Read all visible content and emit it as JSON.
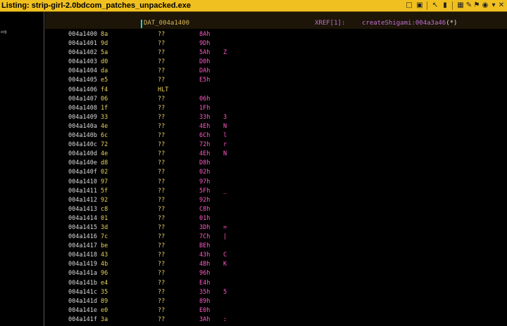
{
  "window": {
    "title": "Listing:  strip-girl-2.0bdcom_patches_unpacked.exe"
  },
  "toolbar_icons": [
    "copy-icon",
    "paste-icon",
    "cursor-icon",
    "arrow-icon",
    "snapshot-icon",
    "edit-icon",
    "flag-icon",
    "camera-icon",
    "options-icon",
    "close-icon"
  ],
  "header": {
    "label": "DAT_004a1400",
    "xref_label": "XREF[1]:",
    "xref_target": "createShigami:004a3a46",
    "xref_mark": "(*)"
  },
  "rows": [
    {
      "addr": "004a1400",
      "byte": "8a",
      "mnem": "??",
      "val": "8Ah",
      "chr": ""
    },
    {
      "addr": "004a1401",
      "byte": "9d",
      "mnem": "??",
      "val": "9Dh",
      "chr": ""
    },
    {
      "addr": "004a1402",
      "byte": "5a",
      "mnem": "??",
      "val": "5Ah",
      "chr": "Z"
    },
    {
      "addr": "004a1403",
      "byte": "d0",
      "mnem": "??",
      "val": "D0h",
      "chr": ""
    },
    {
      "addr": "004a1404",
      "byte": "da",
      "mnem": "??",
      "val": "DAh",
      "chr": ""
    },
    {
      "addr": "004a1405",
      "byte": "e5",
      "mnem": "??",
      "val": "E5h",
      "chr": ""
    },
    {
      "addr": "004a1406",
      "byte": "f4",
      "mnem": "HLT",
      "val": "",
      "chr": ""
    },
    {
      "addr": "004a1407",
      "byte": "06",
      "mnem": "??",
      "val": "06h",
      "chr": ""
    },
    {
      "addr": "004a1408",
      "byte": "1f",
      "mnem": "??",
      "val": "1Fh",
      "chr": ""
    },
    {
      "addr": "004a1409",
      "byte": "33",
      "mnem": "??",
      "val": "33h",
      "chr": "3"
    },
    {
      "addr": "004a140a",
      "byte": "4e",
      "mnem": "??",
      "val": "4Eh",
      "chr": "N"
    },
    {
      "addr": "004a140b",
      "byte": "6c",
      "mnem": "??",
      "val": "6Ch",
      "chr": "l"
    },
    {
      "addr": "004a140c",
      "byte": "72",
      "mnem": "??",
      "val": "72h",
      "chr": "r"
    },
    {
      "addr": "004a140d",
      "byte": "4e",
      "mnem": "??",
      "val": "4Eh",
      "chr": "N"
    },
    {
      "addr": "004a140e",
      "byte": "d8",
      "mnem": "??",
      "val": "D8h",
      "chr": ""
    },
    {
      "addr": "004a140f",
      "byte": "02",
      "mnem": "??",
      "val": "02h",
      "chr": ""
    },
    {
      "addr": "004a1410",
      "byte": "97",
      "mnem": "??",
      "val": "97h",
      "chr": ""
    },
    {
      "addr": "004a1411",
      "byte": "5f",
      "mnem": "??",
      "val": "5Fh",
      "chr": "_"
    },
    {
      "addr": "004a1412",
      "byte": "92",
      "mnem": "??",
      "val": "92h",
      "chr": ""
    },
    {
      "addr": "004a1413",
      "byte": "c8",
      "mnem": "??",
      "val": "C8h",
      "chr": ""
    },
    {
      "addr": "004a1414",
      "byte": "01",
      "mnem": "??",
      "val": "01h",
      "chr": ""
    },
    {
      "addr": "004a1415",
      "byte": "3d",
      "mnem": "??",
      "val": "3Dh",
      "chr": "="
    },
    {
      "addr": "004a1416",
      "byte": "7c",
      "mnem": "??",
      "val": "7Ch",
      "chr": "|"
    },
    {
      "addr": "004a1417",
      "byte": "be",
      "mnem": "??",
      "val": "BEh",
      "chr": ""
    },
    {
      "addr": "004a1418",
      "byte": "43",
      "mnem": "??",
      "val": "43h",
      "chr": "C"
    },
    {
      "addr": "004a1419",
      "byte": "4b",
      "mnem": "??",
      "val": "4Bh",
      "chr": "K"
    },
    {
      "addr": "004a141a",
      "byte": "96",
      "mnem": "??",
      "val": "96h",
      "chr": ""
    },
    {
      "addr": "004a141b",
      "byte": "e4",
      "mnem": "??",
      "val": "E4h",
      "chr": ""
    },
    {
      "addr": "004a141c",
      "byte": "35",
      "mnem": "??",
      "val": "35h",
      "chr": "5"
    },
    {
      "addr": "004a141d",
      "byte": "89",
      "mnem": "??",
      "val": "89h",
      "chr": ""
    },
    {
      "addr": "004a141e",
      "byte": "e0",
      "mnem": "??",
      "val": "E0h",
      "chr": ""
    },
    {
      "addr": "004a141f",
      "byte": "3a",
      "mnem": "??",
      "val": "3Ah",
      "chr": ":"
    }
  ]
}
